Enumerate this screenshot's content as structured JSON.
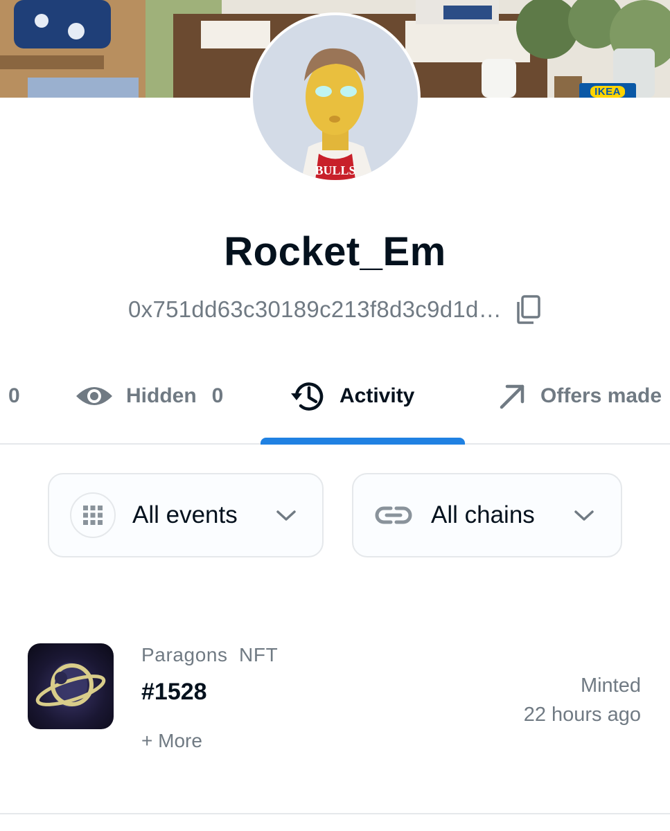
{
  "banner": {
    "badge_text": "IKEA"
  },
  "profile": {
    "username": "Rocket_Em",
    "address": "0x751dd63c30189c213f8d3c9d1d…"
  },
  "tabs": [
    {
      "label": "",
      "count": "0",
      "icon": "unknown"
    },
    {
      "label": "Hidden",
      "count": "0",
      "icon": "eye-icon"
    },
    {
      "label": "Activity",
      "count": "",
      "icon": "history-icon",
      "active": true
    },
    {
      "label": "Offers made",
      "count": "",
      "icon": "arrow-up-right-icon"
    }
  ],
  "filters": {
    "events": {
      "label": "All events",
      "icon": "grid-icon"
    },
    "chains": {
      "label": "All chains",
      "icon": "link-icon"
    }
  },
  "activity": [
    {
      "collection": "Paragons NFT",
      "name": "#1528",
      "more": "+ More",
      "event": "Minted",
      "time": "22 hours ago"
    }
  ],
  "colors": {
    "accent": "#2081e2",
    "text_primary": "#04111d",
    "text_secondary": "#707a83",
    "border": "#e5e8eb"
  }
}
